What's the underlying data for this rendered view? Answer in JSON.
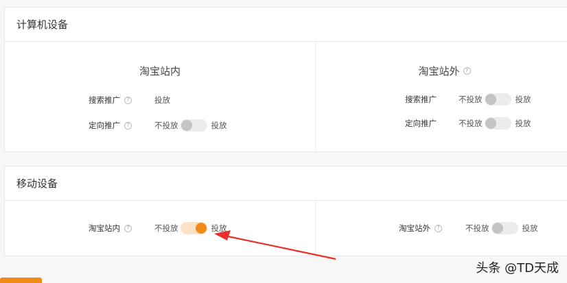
{
  "computer": {
    "title": "计算机设备",
    "left": {
      "title": "淘宝站内",
      "rows": [
        {
          "label": "搜索推广",
          "value": "投放"
        },
        {
          "label": "定向推广",
          "off": "不投放",
          "on": "投放",
          "enabled": false
        }
      ]
    },
    "right": {
      "title": "淘宝站外",
      "rows": [
        {
          "label": "搜索推广",
          "off": "不投放",
          "on": "投放",
          "enabled": false
        },
        {
          "label": "定向推广",
          "off": "不投放",
          "on": "投放",
          "enabled": false
        }
      ]
    }
  },
  "mobile": {
    "title": "移动设备",
    "left": {
      "label": "淘宝站内",
      "off": "不投放",
      "on": "投放",
      "enabled": true
    },
    "right": {
      "label": "淘宝站外",
      "off": "不投放",
      "on": "投放",
      "enabled": false
    }
  },
  "help_icon": "question-circle",
  "accent_color": "#f28a18",
  "arrow_color": "#e8312a",
  "watermark": "头条 @TD天成"
}
